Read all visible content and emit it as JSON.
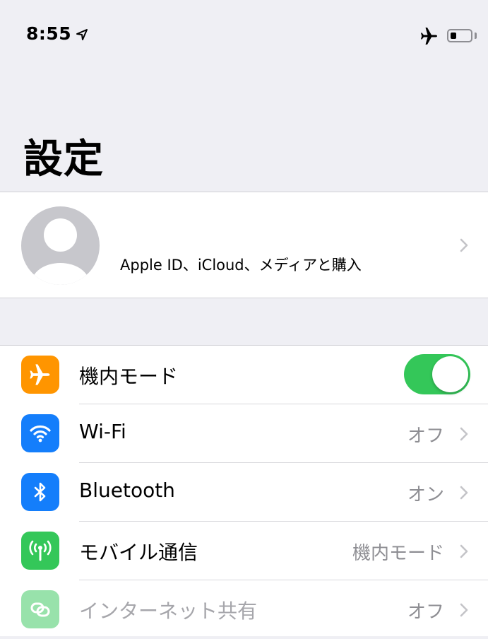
{
  "status_bar": {
    "time": "8:55",
    "location_icon": "location-arrow-icon",
    "airplane_icon": "airplane-icon",
    "battery_level_fraction": 0.3
  },
  "page": {
    "title": "設定"
  },
  "profile": {
    "subtitle": "Apple ID、iCloud、メディアと購入",
    "avatar_icon": "person-placeholder-icon"
  },
  "settings": {
    "items": [
      {
        "label": "機内モード",
        "icon": "airplane-icon",
        "icon_color": "#ff9500",
        "control": "toggle",
        "toggle_on": true
      },
      {
        "label": "Wi-Fi",
        "icon": "wifi-icon",
        "icon_color": "#147efb",
        "value": "オフ"
      },
      {
        "label": "Bluetooth",
        "icon": "bluetooth-icon",
        "icon_color": "#147efb",
        "value": "オン"
      },
      {
        "label": "モバイル通信",
        "icon": "antenna-icon",
        "icon_color": "#34c759",
        "value": "機内モード"
      },
      {
        "label": "インターネット共有",
        "icon": "link-icon",
        "icon_color": "#34c759",
        "value": "オフ",
        "disabled": true
      }
    ]
  },
  "colors": {
    "toggle_on": "#34c759",
    "background": "#efeff4",
    "secondary_text": "#8e8e93"
  }
}
